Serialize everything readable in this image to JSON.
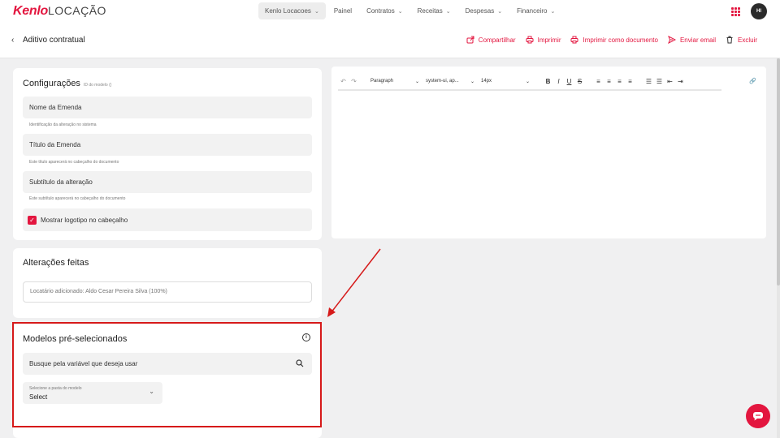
{
  "app": {
    "brand": "Kenlo",
    "brand_suffix": "LOCAÇÃO"
  },
  "nav": [
    {
      "label": "Kenlo Locacoes",
      "dropdown": true,
      "active": true
    },
    {
      "label": "Painel",
      "dropdown": false
    },
    {
      "label": "Contratos",
      "dropdown": true
    },
    {
      "label": "Receitas",
      "dropdown": true
    },
    {
      "label": "Despesas",
      "dropdown": true
    },
    {
      "label": "Financeiro",
      "dropdown": true
    }
  ],
  "user": {
    "initials": "HI"
  },
  "page": {
    "back_icon": "chevron-left",
    "title": "Aditivo contratual"
  },
  "actions": {
    "share": "Compartilhar",
    "print": "Imprimir",
    "print_doc": "Imprimir como documento",
    "email": "Enviar email",
    "delete": "Excluir"
  },
  "config": {
    "title": "Configurações",
    "model_id": "ID do modelo ()",
    "fields": [
      {
        "label": "Nome da Emenda",
        "hint": "Identificação da alteração no sistema"
      },
      {
        "label": "Título da Emenda",
        "hint": "Este título aparecerá no cabeçalho do documento"
      },
      {
        "label": "Subtítulo da alteração",
        "hint": "Este subtítulo aparecerá no cabeçalho do documento"
      }
    ],
    "checkbox_label": "Mostrar logotipo no cabeçalho",
    "checkbox_checked": true
  },
  "changes": {
    "title": "Alterações feitas",
    "value": "Locatário adicionado: Aldo Cesar Pereira Silva (100%)"
  },
  "models": {
    "title": "Modelos pré-selecionados",
    "search_placeholder": "Busque pela variável que deseja usar",
    "folder_label": "Selecione a pasta do modelo",
    "folder_value": "Select"
  },
  "editor": {
    "block_format": "Paragraph",
    "font_family": "system-ui, ap...",
    "font_size": "14px",
    "buttons": {
      "undo": "↶",
      "redo": "↷",
      "bold": "B",
      "italic": "I",
      "underline": "U",
      "strike": "S",
      "align_left": "≡",
      "align_center": "≡",
      "align_right": "≡",
      "justify": "≡",
      "bullets": "☰",
      "numbers": "☰",
      "outdent": "⇤",
      "indent": "⇥",
      "link": "🔗"
    }
  },
  "colors": {
    "accent": "#e3163f",
    "annotation": "#d61a1a"
  }
}
